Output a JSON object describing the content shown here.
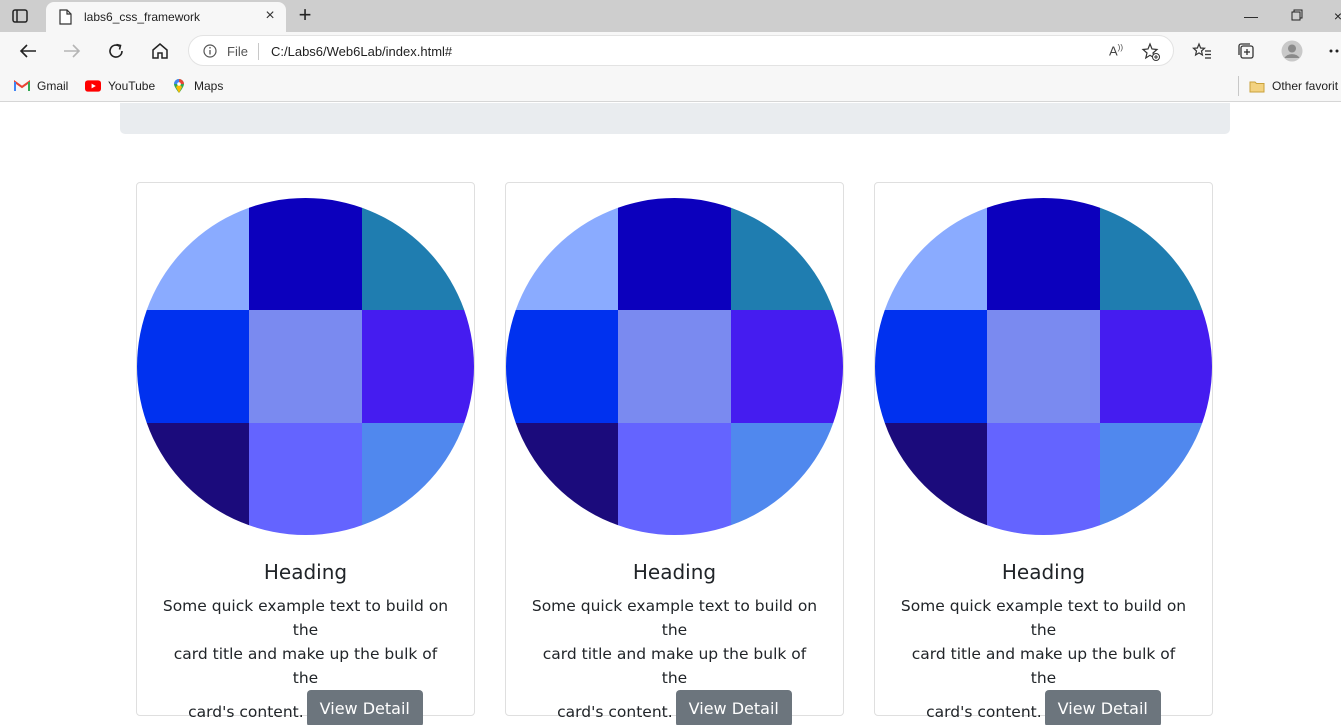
{
  "browser": {
    "tab_title": "labs6_css_framework",
    "address_label": "File",
    "url": "C:/Labs6/Web6Lab/index.html#",
    "bookmarks": [
      {
        "label": "Gmail",
        "icon": "gmail-icon"
      },
      {
        "label": "YouTube",
        "icon": "youtube-icon"
      },
      {
        "label": "Maps",
        "icon": "maps-icon"
      }
    ],
    "other_favorites": "Other favorit"
  },
  "cards": [
    {
      "heading": "Heading",
      "text_line1": "Some quick example text to build on the",
      "text_line2": "card title and make up the bulk of the",
      "text_line3": "card's content.",
      "button": "View Detail"
    },
    {
      "heading": "Heading",
      "text_line1": "Some quick example text to build on the",
      "text_line2": "card title and make up the bulk of the",
      "text_line3": "card's content.",
      "button": "View Detail"
    },
    {
      "heading": "Heading",
      "text_line1": "Some quick example text to build on the",
      "text_line2": "card title and make up the bulk of the",
      "text_line3": "card's content.",
      "button": "View Detail"
    }
  ],
  "image_grid_colors": [
    "#8aabff",
    "#0c00bd",
    "#1f7db0",
    "#0031ef",
    "#7a8af0",
    "#451cf0",
    "#1b0b7c",
    "#6464ff",
    "#5088ee"
  ],
  "colors": {
    "button_bg": "#6c757d",
    "jumbotron_bg": "#e9ecef"
  }
}
